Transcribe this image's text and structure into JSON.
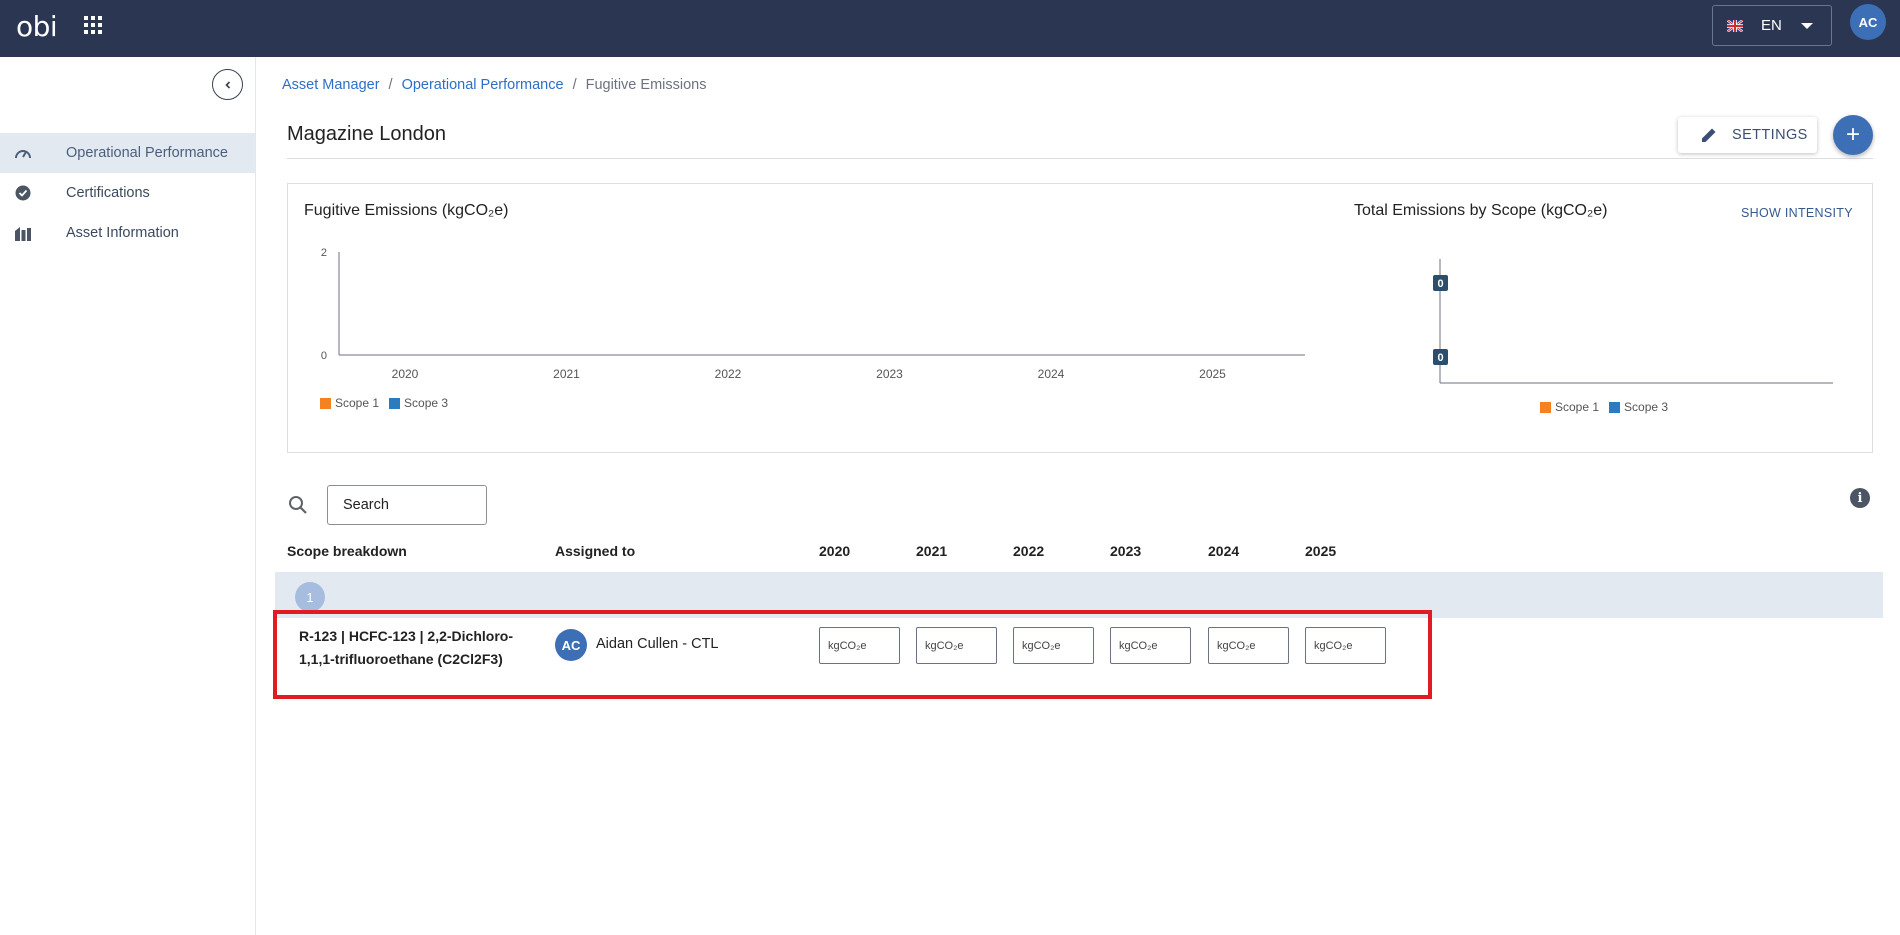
{
  "topbar": {
    "logo": "obi",
    "language": "EN",
    "user_initials": "AC"
  },
  "sidebar": {
    "items": [
      {
        "label": "Operational Performance",
        "icon": "speedometer-icon",
        "active": true
      },
      {
        "label": "Certifications",
        "icon": "badge-check-icon",
        "active": false
      },
      {
        "label": "Asset Information",
        "icon": "buildings-icon",
        "active": false
      }
    ]
  },
  "breadcrumb": {
    "items": [
      "Asset Manager",
      "Operational Performance",
      "Fugitive Emissions"
    ],
    "separator": "/"
  },
  "page": {
    "title": "Magazine London",
    "settings_label": "SETTINGS",
    "add_label": "+"
  },
  "chart_data": [
    {
      "type": "bar",
      "title": "Fugitive Emissions (kgCO₂e)",
      "categories": [
        "2020",
        "2021",
        "2022",
        "2023",
        "2024",
        "2025"
      ],
      "series": [
        {
          "name": "Scope 1",
          "color": "#f58220",
          "values": [
            0,
            0,
            0,
            0,
            0,
            0
          ]
        },
        {
          "name": "Scope 3",
          "color": "#2b7bbf",
          "values": [
            0,
            0,
            0,
            0,
            0,
            0
          ]
        }
      ],
      "y_ticks": [
        "2",
        "0"
      ],
      "ylim": [
        0,
        2
      ],
      "legend_position": "bottom-left"
    },
    {
      "type": "bar",
      "orientation": "horizontal",
      "title": "Total Emissions by Scope (kgCO₂e)",
      "action_label": "SHOW INTENSITY",
      "series": [
        {
          "name": "Scope 1",
          "color": "#f58220",
          "value": 0,
          "label": "0"
        },
        {
          "name": "Scope 3",
          "color": "#2b7bbf",
          "value": 0,
          "label": "0"
        }
      ],
      "legend_position": "bottom-center"
    }
  ],
  "search": {
    "placeholder": "Search"
  },
  "table": {
    "headers": {
      "scope": "Scope breakdown",
      "assigned": "Assigned to",
      "years": [
        "2020",
        "2021",
        "2022",
        "2023",
        "2024",
        "2025"
      ]
    },
    "group_badge": "1",
    "rows": [
      {
        "name_line1": "R-123 | HCFC-123 | 2,2-Dichloro-",
        "name_line2": "1,1,1-trifluoroethane (C2Cl2F3)",
        "assignee_initials": "AC",
        "assignee_name": "Aidan Cullen - CTL",
        "unit_placeholder": "kgCO₂e"
      }
    ]
  },
  "colors": {
    "topbar": "#2a3652",
    "accent": "#3d6fb6",
    "link": "#2d6fc6",
    "highlight": "#e01b22",
    "scope1": "#f58220",
    "scope3": "#2b7bbf"
  }
}
